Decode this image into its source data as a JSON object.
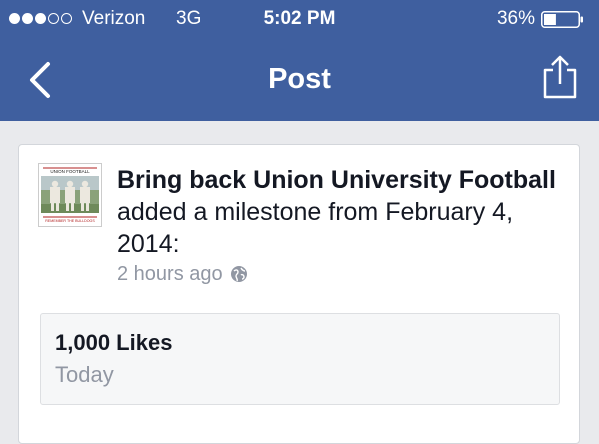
{
  "status_bar": {
    "signal_bars_filled": 3,
    "signal_bars_total": 5,
    "carrier": "Verizon",
    "network": "3G",
    "time": "5:02 PM",
    "battery_percent": "36%",
    "battery_level": 0.36
  },
  "nav": {
    "title": "Post",
    "back_icon": "chevron-left-icon",
    "share_icon": "share-icon"
  },
  "post": {
    "page_name": "Bring back Union University Football",
    "action": "added a milestone from February 4, 2014:",
    "timestamp": "2 hours ago",
    "audience_icon": "globe-icon",
    "thumbnail": {
      "banner_text": "UNION FOOTBALL",
      "caption_text": "REMEMBER THE BULLDOGS"
    }
  },
  "milestone": {
    "title": "1,000 Likes",
    "date": "Today"
  },
  "colors": {
    "header": "#3f5f9f",
    "background": "#e9eaed",
    "card": "#ffffff",
    "text": "#141823",
    "muted": "#9197a3"
  }
}
